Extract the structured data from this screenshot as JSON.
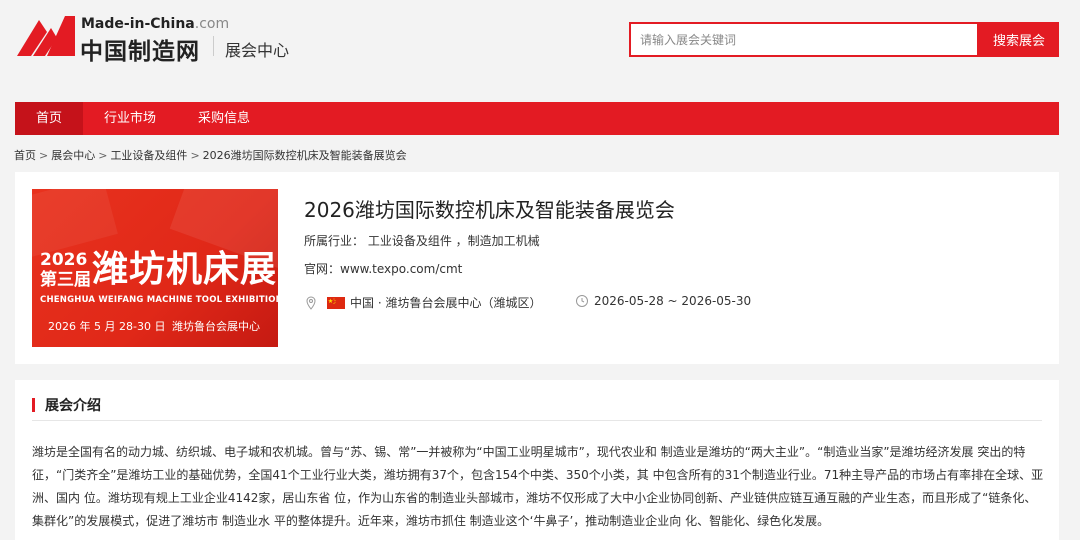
{
  "header": {
    "brand_en": "Made-in-China",
    "brand_en_suffix": ".com",
    "brand_cn": "中国制造网",
    "section": "展会中心",
    "search_placeholder": "请输入展会关键词",
    "search_button": "搜索展会",
    "accent_color": "#e31b23"
  },
  "nav": {
    "items": [
      {
        "label": "首页",
        "active": true
      },
      {
        "label": "行业市场",
        "active": false
      },
      {
        "label": "采购信息",
        "active": false
      }
    ]
  },
  "breadcrumb": {
    "items": [
      "首页",
      "展会中心",
      "工业设备及组件",
      "2026潍坊国际数控机床及智能装备展览会"
    ],
    "separator": ">"
  },
  "exhibition": {
    "banner": {
      "year": "2026",
      "session": "第三届",
      "title": "潍坊机床展",
      "english": "CHENGHUA WEIFANG MACHINE TOOL EXHIBITION",
      "date": "2026 年 5 月 28-30 日",
      "venue": "潍坊鲁台会展中心"
    },
    "title": "2026潍坊国际数控机床及智能装备展览会",
    "industry_label": "所属行业：",
    "industry_value": "工业设备及组件 ，制造加工机械",
    "website_label": "官网：",
    "website_value": "www.texpo.com/cmt",
    "location": "中国 · 潍坊鲁台会展中心（潍城区）",
    "date_range": "2026-05-28 ~ 2026-05-30"
  },
  "intro": {
    "heading": "展会介绍",
    "text": "潍坊是全国有名的动力城、纺织城、电子城和农机城。曾与“苏、锡、常”一并被称为“中国工业明星城市”，现代农业和 制造业是潍坊的“两大主业”。“制造业当家”是潍坊经济发展 突出的特征，“门类齐全”是潍坊工业的基础优势，全国41个工业行业大类，潍坊拥有37个，包含154个中类、350个小类，其 中包含所有的31个制造业行业。71种主导产品的市场占有率排在全球、亚洲、国内 位。潍坊现有规上工业企业4142家，居山东省 位，作为山东省的制造业头部城市，潍坊不仅形成了大中小企业协同创新、产业链供应链互通互融的产业生态，而且形成了“链条化、集群化”的发展模式，促进了潍坊市 制造业水 平的整体提升。近年来，潍坊市抓住 制造业这个‘牛鼻子’，推动制造业企业向 化、智能化、绿色化发展。"
  }
}
